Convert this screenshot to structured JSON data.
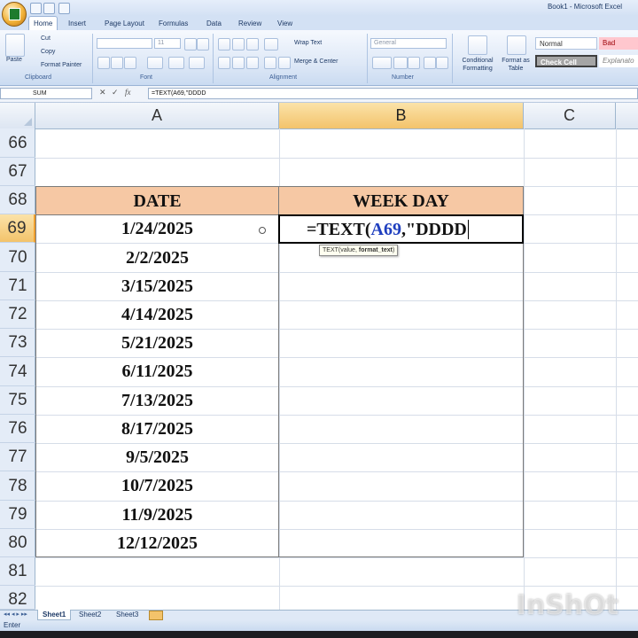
{
  "app": {
    "window_title": "Book1 - Microsoft Excel"
  },
  "ribbon_tabs": [
    "Home",
    "Insert",
    "Page Layout",
    "Formulas",
    "Data",
    "Review",
    "View"
  ],
  "ribbon": {
    "clipboard": {
      "paste": "Paste",
      "cut": "Cut",
      "copy": "Copy",
      "format_painter": "Format Painter",
      "group": "Clipboard"
    },
    "font": {
      "size": "11",
      "group": "Font"
    },
    "alignment": {
      "wrap_text": "Wrap Text",
      "merge_center": "Merge & Center",
      "group": "Alignment"
    },
    "number": {
      "format": "General",
      "group": "Number"
    },
    "styles": {
      "conditional": "Conditional Formatting",
      "format_table": "Format as Table",
      "normal": "Normal",
      "bad": "Bad",
      "check_cell": "Check Cell",
      "explanatory": "Explanato"
    }
  },
  "formula_bar": {
    "name_box": "SUM",
    "formula": "=TEXT(A69,\"DDDD"
  },
  "columns": [
    "A",
    "B",
    "C"
  ],
  "rows": [
    "66",
    "67",
    "68",
    "69",
    "70",
    "71",
    "72",
    "73",
    "74",
    "75",
    "76",
    "77",
    "78",
    "79",
    "80",
    "81",
    "82"
  ],
  "table": {
    "header_date": "DATE",
    "header_weekday": "WEEK DAY",
    "dates": [
      "1/24/2025",
      "2/2/2025",
      "3/15/2025",
      "4/14/2025",
      "5/21/2025",
      "6/11/2025",
      "7/13/2025",
      "8/17/2025",
      "9/5/2025",
      "10/7/2025",
      "11/9/2025",
      "12/12/2025"
    ]
  },
  "editing": {
    "prefix": "=TEXT(",
    "ref": "A69",
    "suffix": ",\"DDDD",
    "ref_color": "#1f3fbf",
    "tooltip_func": "TEXT(value, ",
    "tooltip_arg": "format_text",
    "tooltip_end": ")"
  },
  "sheets": [
    "Sheet1",
    "Sheet2",
    "Sheet3"
  ],
  "status": "Enter",
  "watermark": "InShOt",
  "colors": {
    "header_fill": "#f6c8a4",
    "selected_header": "#f3c36b"
  }
}
